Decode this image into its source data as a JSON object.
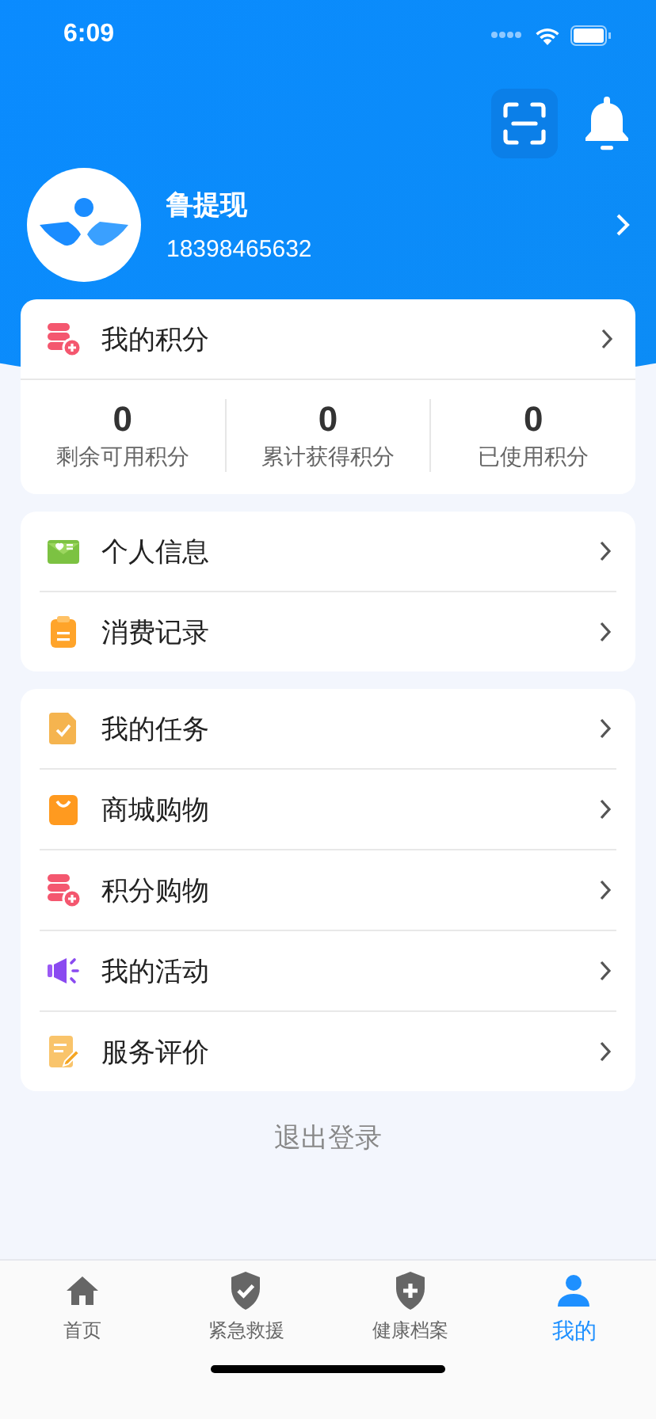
{
  "status_bar": {
    "time": "6:09"
  },
  "profile": {
    "name": "鲁提现",
    "phone": "18398465632"
  },
  "points": {
    "title": "我的积分",
    "stats": [
      {
        "value": "0",
        "label": "剩余可用积分"
      },
      {
        "value": "0",
        "label": "累计获得积分"
      },
      {
        "value": "0",
        "label": "已使用积分"
      }
    ]
  },
  "menu_groups": [
    [
      {
        "kind": "profile",
        "label": "个人信息"
      },
      {
        "kind": "records",
        "label": "消费记录"
      }
    ],
    [
      {
        "kind": "task",
        "label": "我的任务"
      },
      {
        "kind": "shop",
        "label": "商城购物"
      },
      {
        "kind": "points",
        "label": "积分购物"
      },
      {
        "kind": "activity",
        "label": "我的活动"
      },
      {
        "kind": "review",
        "label": "服务评价"
      }
    ]
  ],
  "logout": "退出登录",
  "tab_bar": [
    {
      "kind": "home",
      "label": "首页",
      "selected": false
    },
    {
      "kind": "rescue",
      "label": "紧急救援",
      "selected": false
    },
    {
      "kind": "health",
      "label": "健康档案",
      "selected": false
    },
    {
      "kind": "me",
      "label": "我的",
      "selected": true
    }
  ]
}
